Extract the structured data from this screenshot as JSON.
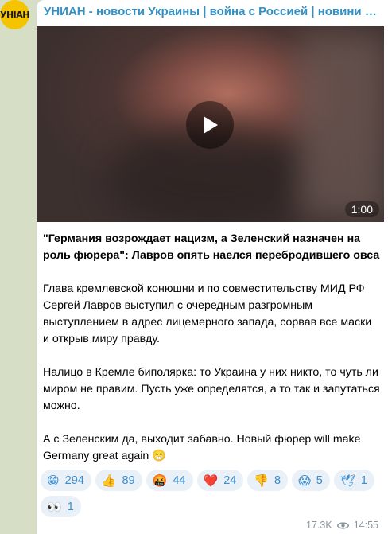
{
  "avatar": {
    "text": "УНІАН",
    "color": "#f5c400"
  },
  "channel": {
    "title": "УНИАН - новости Украины | война с Россией | новини України..."
  },
  "media": {
    "duration": "1:00",
    "icon": "play-icon"
  },
  "post": {
    "headline": "\"Германия возрождает нацизм, а Зеленский назначен на роль фюрера\": Лавров опять наелся перебродившего овса",
    "paragraphs": [
      "Глава кремлевской конюшни и по совместительству МИД РФ Сергей Лавров выступил с очередным разгромным выступлением в адрес лицемерного запада, сорвав все маски и открыв миру правду.",
      "Налицо в Кремле биполярка: то Украина у них никто, то чуть ли миром не правим. Пусть уже определятся, а то так и запутаться можно.",
      "А с Зеленским да, выходит забавно. Новый фюрер will make Germany great again 😁"
    ]
  },
  "reactions": [
    {
      "emoji": "😁",
      "count": "294"
    },
    {
      "emoji": "👍",
      "count": "89"
    },
    {
      "emoji": "🤬",
      "count": "44"
    },
    {
      "emoji": "❤️",
      "count": "24"
    },
    {
      "emoji": "👎",
      "count": "8"
    },
    {
      "emoji": "😱",
      "count": "5"
    },
    {
      "emoji": "🕊",
      "count": "1"
    },
    {
      "emoji": "👀",
      "count": "1"
    }
  ],
  "meta": {
    "views": "17.3K",
    "time": "14:55",
    "views_icon": "eye-icon"
  }
}
